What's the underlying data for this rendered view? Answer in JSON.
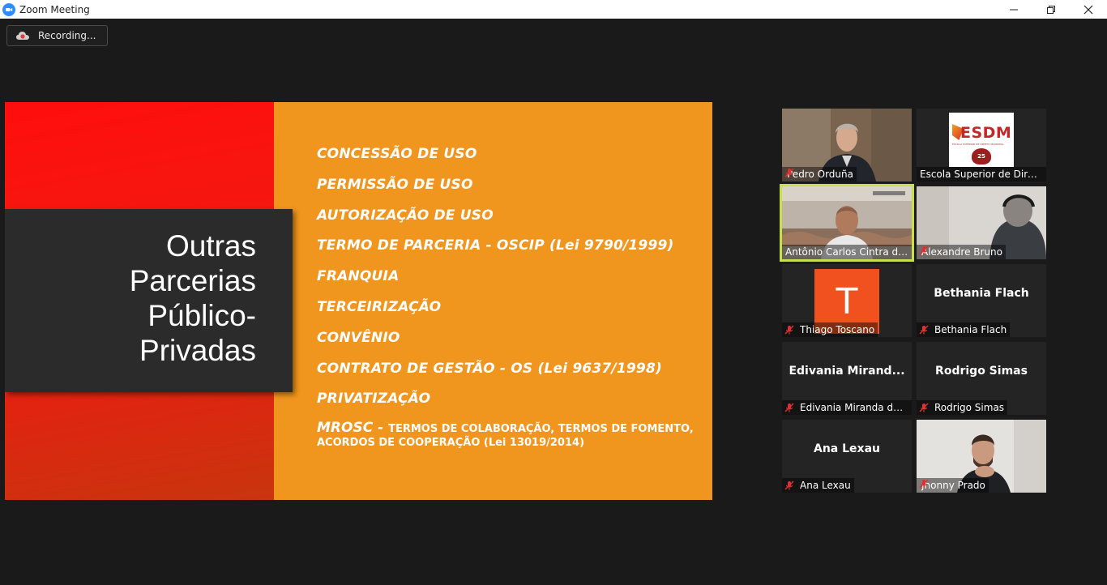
{
  "window": {
    "title": "Zoom Meeting"
  },
  "recording": {
    "label": "Recording..."
  },
  "slide": {
    "title_lines": [
      "Outras",
      "Parcerias",
      "Público-",
      "Privadas"
    ],
    "bullets": [
      "CONCESSÃO DE USO",
      "PERMISSÃO DE USO",
      "AUTORIZAÇÃO DE USO",
      "TERMO DE PARCERIA - OSCIP (Lei 9790/1999)",
      "FRANQUIA",
      "TERCEIRIZAÇÃO",
      "CONVÊNIO",
      "CONTRATO DE GESTÃO - OS (Lei 9637/1998)",
      "PRIVATIZAÇÃO"
    ],
    "last_bullet_lead": "MROSC - ",
    "last_bullet_text": "TERMOS DE COLABORAÇÃO, TERMOS DE FOMENTO, ACORDOS DE COOPERAÇÃO (Lei 13019/2014)"
  },
  "participants": [
    {
      "name": "Pedro Orduña",
      "type": "video"
    },
    {
      "name": "Escola Superior de Direi...",
      "type": "logo",
      "logo_text": "ESDM",
      "logo_sub": "ESCOLA SUPERIOR DE DIREITO MUNICIPAL",
      "badge": "25"
    },
    {
      "name": "Antônio Carlos Cintra do...",
      "type": "video",
      "active": true
    },
    {
      "name": "Alexandre Bruno",
      "type": "video"
    },
    {
      "name": "Thiago Toscano",
      "type": "avatar",
      "initial": "T"
    },
    {
      "name": "Bethania Flach",
      "type": "name",
      "display": "Bethania Flach"
    },
    {
      "name": "Edivania Miranda da ...",
      "type": "name",
      "display": "Edivania  Mirand..."
    },
    {
      "name": "Rodrigo Simas",
      "type": "name",
      "display": "Rodrigo Simas"
    },
    {
      "name": "Ana Lexau",
      "type": "name",
      "display": "Ana Lexau"
    },
    {
      "name": "Jhonny Prado",
      "type": "video"
    }
  ],
  "colors": {
    "accent_active": "#c7e04a",
    "slide_orange": "#f0951e",
    "slide_red": "#ff0e0e",
    "avatar_orange": "#f0511e",
    "muted_mic": "#e03030"
  }
}
